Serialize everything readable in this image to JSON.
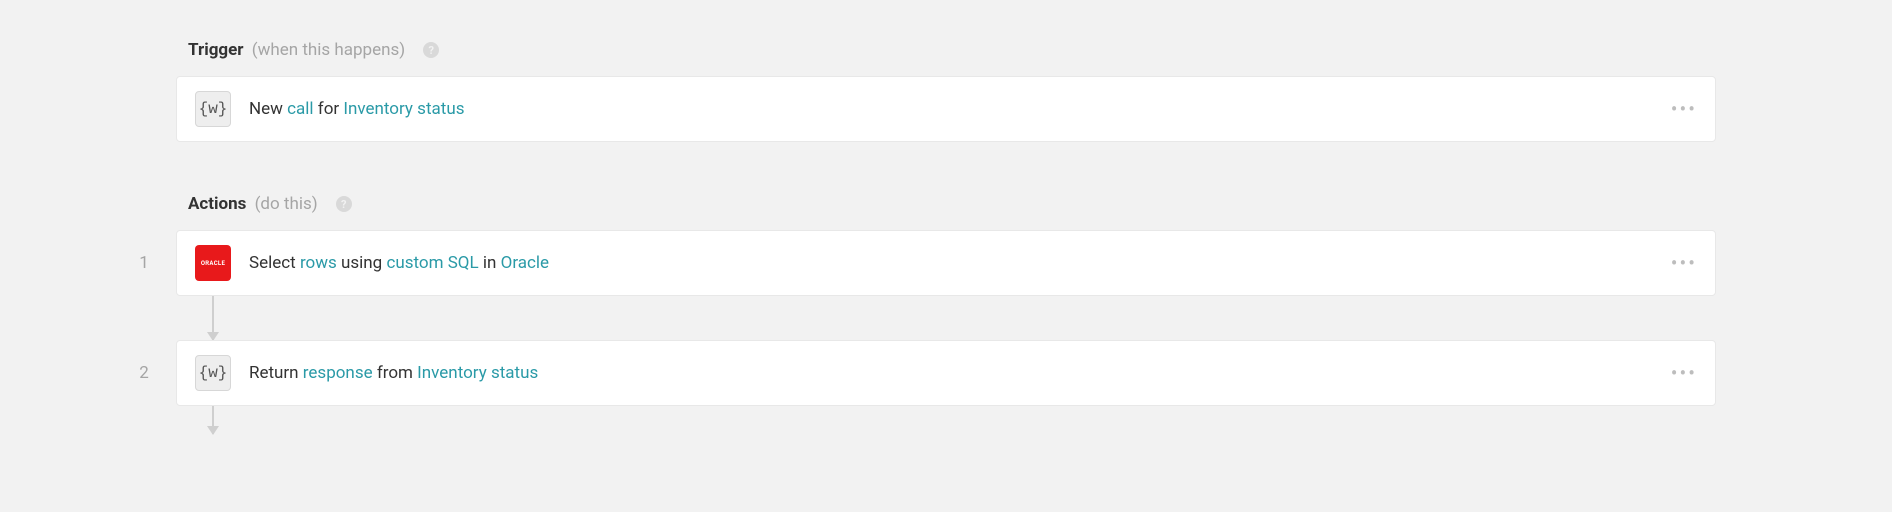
{
  "trigger": {
    "header": {
      "title": "Trigger",
      "subtitle": "(when this happens)"
    },
    "card": {
      "iconGlyph": "{w}",
      "t0": "New ",
      "l0": "call",
      "t1": " for ",
      "l1": "Inventory status"
    }
  },
  "actions": {
    "header": {
      "title": "Actions",
      "subtitle": "(do this)"
    },
    "steps": [
      {
        "number": "1",
        "iconType": "oracle",
        "iconGlyph": "ORACLE",
        "t0": "Select ",
        "l0": "rows",
        "t1": " using ",
        "l1": "custom SQL",
        "t2": " in ",
        "l2": "Oracle"
      },
      {
        "number": "2",
        "iconType": "w",
        "iconGlyph": "{w}",
        "t0": "Return ",
        "l0": "response",
        "t1": " from ",
        "l1": "Inventory status"
      }
    ]
  }
}
